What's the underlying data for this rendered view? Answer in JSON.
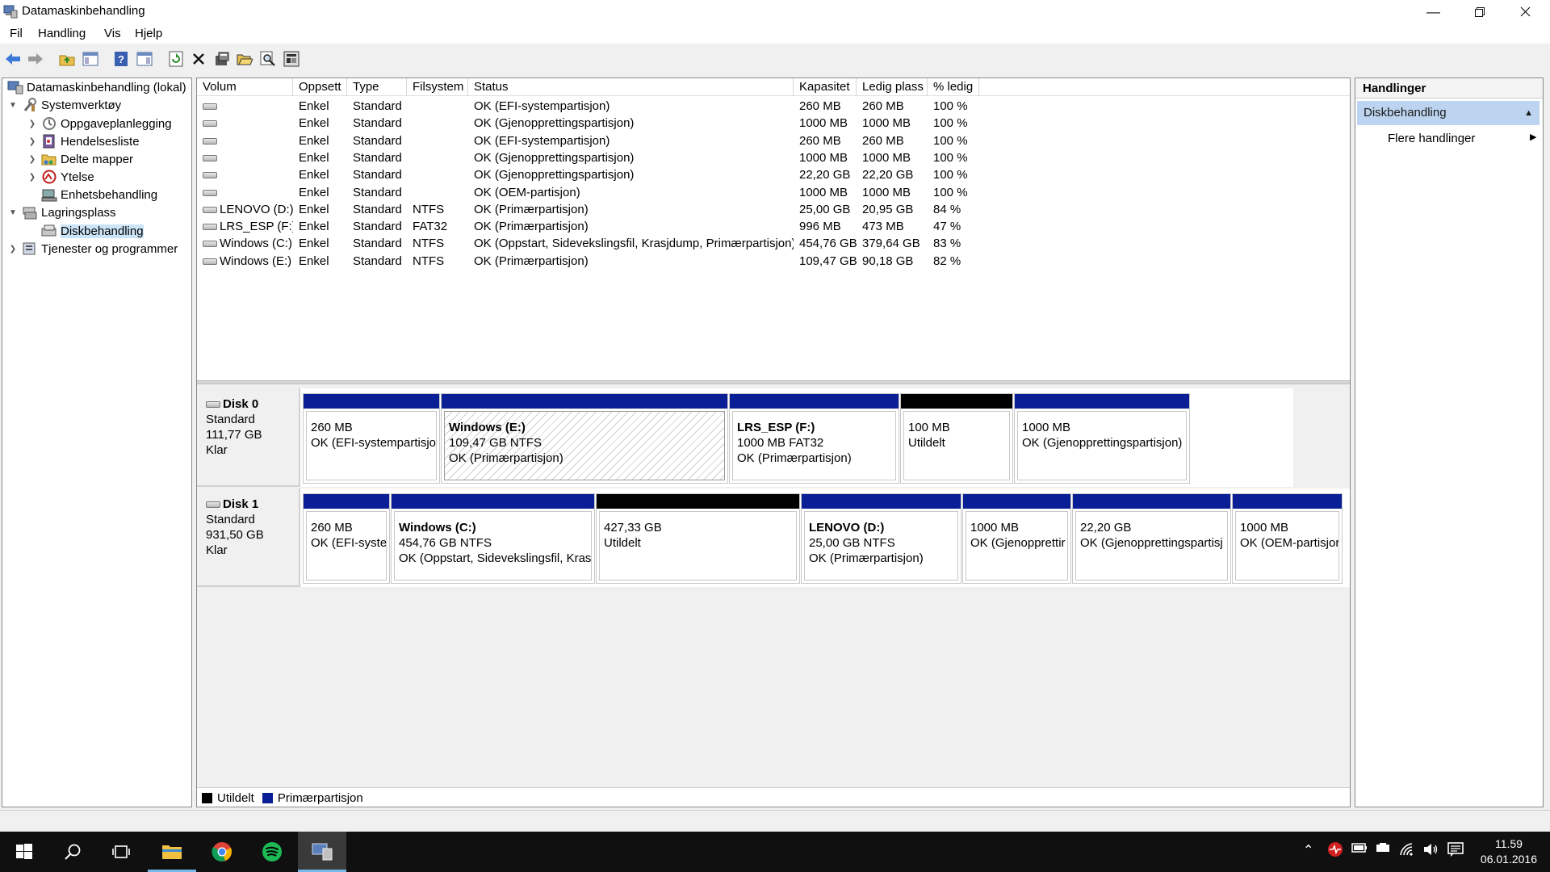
{
  "window": {
    "title": "Datamaskinbehandling"
  },
  "menu": [
    "Fil",
    "Handling",
    "Vis",
    "Hjelp"
  ],
  "tree": {
    "root": "Datamaskinbehandling (lokal)",
    "system_tools": "Systemverktøy",
    "task_scheduler": "Oppgaveplanlegging",
    "event_viewer": "Hendelsesliste",
    "shared_folders": "Delte mapper",
    "performance": "Ytelse",
    "device_manager": "Enhetsbehandling",
    "storage": "Lagringsplass",
    "disk_management": "Diskbehandling",
    "services": "Tjenester og programmer"
  },
  "volume_table": {
    "headers": [
      "Volum",
      "Oppsett",
      "Type",
      "Filsystem",
      "Status",
      "Kapasitet",
      "Ledig plass",
      "% ledig"
    ],
    "rows": [
      [
        "",
        "Enkel",
        "Standard",
        "",
        "OK (EFI-systempartisjon)",
        "260 MB",
        "260 MB",
        "100 %"
      ],
      [
        "",
        "Enkel",
        "Standard",
        "",
        "OK (Gjenopprettingspartisjon)",
        "1000 MB",
        "1000 MB",
        "100 %"
      ],
      [
        "",
        "Enkel",
        "Standard",
        "",
        "OK (EFI-systempartisjon)",
        "260 MB",
        "260 MB",
        "100 %"
      ],
      [
        "",
        "Enkel",
        "Standard",
        "",
        "OK (Gjenopprettingspartisjon)",
        "1000 MB",
        "1000 MB",
        "100 %"
      ],
      [
        "",
        "Enkel",
        "Standard",
        "",
        "OK (Gjenopprettingspartisjon)",
        "22,20 GB",
        "22,20 GB",
        "100 %"
      ],
      [
        "",
        "Enkel",
        "Standard",
        "",
        "OK (OEM-partisjon)",
        "1000 MB",
        "1000 MB",
        "100 %"
      ],
      [
        "LENOVO (D:)",
        "Enkel",
        "Standard",
        "NTFS",
        "OK (Primærpartisjon)",
        "25,00 GB",
        "20,95 GB",
        "84 %"
      ],
      [
        "LRS_ESP (F:)",
        "Enkel",
        "Standard",
        "FAT32",
        "OK (Primærpartisjon)",
        "996 MB",
        "473 MB",
        "47 %"
      ],
      [
        "Windows (C:)",
        "Enkel",
        "Standard",
        "NTFS",
        "OK (Oppstart, Sidevekslingsfil, Krasjdump, Primærpartisjon)",
        "454,76 GB",
        "379,64 GB",
        "83 %"
      ],
      [
        "Windows (E:)",
        "Enkel",
        "Standard",
        "NTFS",
        "OK (Primærpartisjon)",
        "109,47 GB",
        "90,18 GB",
        "82 %"
      ]
    ]
  },
  "disk0": {
    "name": "Disk 0",
    "type": "Standard",
    "size": "111,77 GB",
    "state": "Klar",
    "p1": {
      "l1": "260 MB",
      "l2": "OK (EFI-systempartisjo"
    },
    "p2": {
      "title": "Windows  (E:)",
      "l1": "109,47 GB NTFS",
      "l2": "OK (Primærpartisjon)"
    },
    "p3": {
      "title": "LRS_ESP  (F:)",
      "l1": "1000 MB FAT32",
      "l2": "OK (Primærpartisjon)"
    },
    "p4": {
      "l1": "100 MB",
      "l2": "Utildelt"
    },
    "p5": {
      "l1": "1000 MB",
      "l2": "OK (Gjenopprettingspartisjon)"
    }
  },
  "disk1": {
    "name": "Disk 1",
    "type": "Standard",
    "size": "931,50 GB",
    "state": "Klar",
    "p1": {
      "l1": "260 MB",
      "l2": "OK (EFI-systen"
    },
    "p2": {
      "title": "Windows  (C:)",
      "l1": "454,76 GB NTFS",
      "l2": "OK (Oppstart, Sidevekslingsfil, Krasjc"
    },
    "p3": {
      "l1": "427,33 GB",
      "l2": "Utildelt"
    },
    "p4": {
      "title": "LENOVO  (D:)",
      "l1": "25,00 GB NTFS",
      "l2": "OK (Primærpartisjon)"
    },
    "p5": {
      "l1": "1000 MB",
      "l2": "OK (Gjenopprettir"
    },
    "p6": {
      "l1": "22,20 GB",
      "l2": "OK (Gjenopprettingspartisj"
    },
    "p7": {
      "l1": "1000 MB",
      "l2": "OK (OEM-partisjor"
    }
  },
  "legend": {
    "unallocated": "Utildelt",
    "primary": "Primærpartisjon"
  },
  "actions": {
    "header": "Handlinger",
    "section": "Diskbehandling",
    "more": "Flere handlinger"
  },
  "clock": {
    "time": "11.59",
    "date": "06.01.2016"
  },
  "colors": {
    "primary_bar": "#0a1e96",
    "unallocated_bar": "#000000",
    "selection": "#cce4f7",
    "action_section": "#bcd4ef"
  }
}
